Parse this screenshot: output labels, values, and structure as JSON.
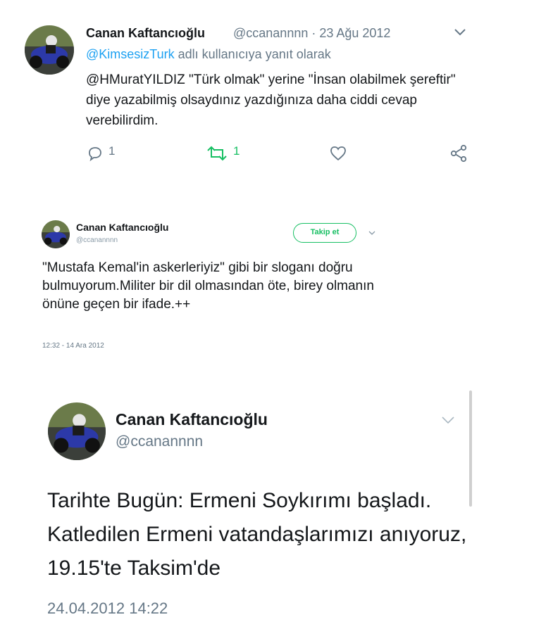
{
  "tweet1": {
    "name": "Canan Kaftancıoğlu",
    "handle_date": "@ccanannnn · 23 Ağu 2012",
    "reply_mention": "@KimsesizTurk",
    "reply_suffix": " adlı kullanıcıya yanıt olarak",
    "body": "@HMuratYILDIZ  \"Türk olmak\" yerine \"İnsan olabilmek şereftir\" diye yazabilmiş olsaydınız yazdığınıza daha ciddi cevap verebilirdim.",
    "reply_count": "1",
    "retweet_count": "1"
  },
  "tweet2": {
    "name": "Canan Kaftancıoğlu",
    "handle": "@ccanannnn",
    "follow_label": "Takip et",
    "body": "\"Mustafa Kemal'in askerleriyiz\" gibi bir sloganı doğru bulmuyorum.Militer bir dil olmasından öte, birey olmanın önüne geçen bir ifade.++",
    "timestamp": "12:32 - 14 Ara 2012"
  },
  "tweet3": {
    "name": "Canan Kaftancıoğlu",
    "handle": "@ccanannnn",
    "body": "Tarihte Bugün: Ermeni Soykırımı başladı. Katledilen Ermeni vatandaşlarımızı anıyoruz, 19.15'te Taksim'de",
    "timestamp": "24.04.2012 14:22"
  },
  "colors": {
    "link": "#1da1f2",
    "retweet_green": "#17bf63",
    "secondary_text": "#657786"
  }
}
